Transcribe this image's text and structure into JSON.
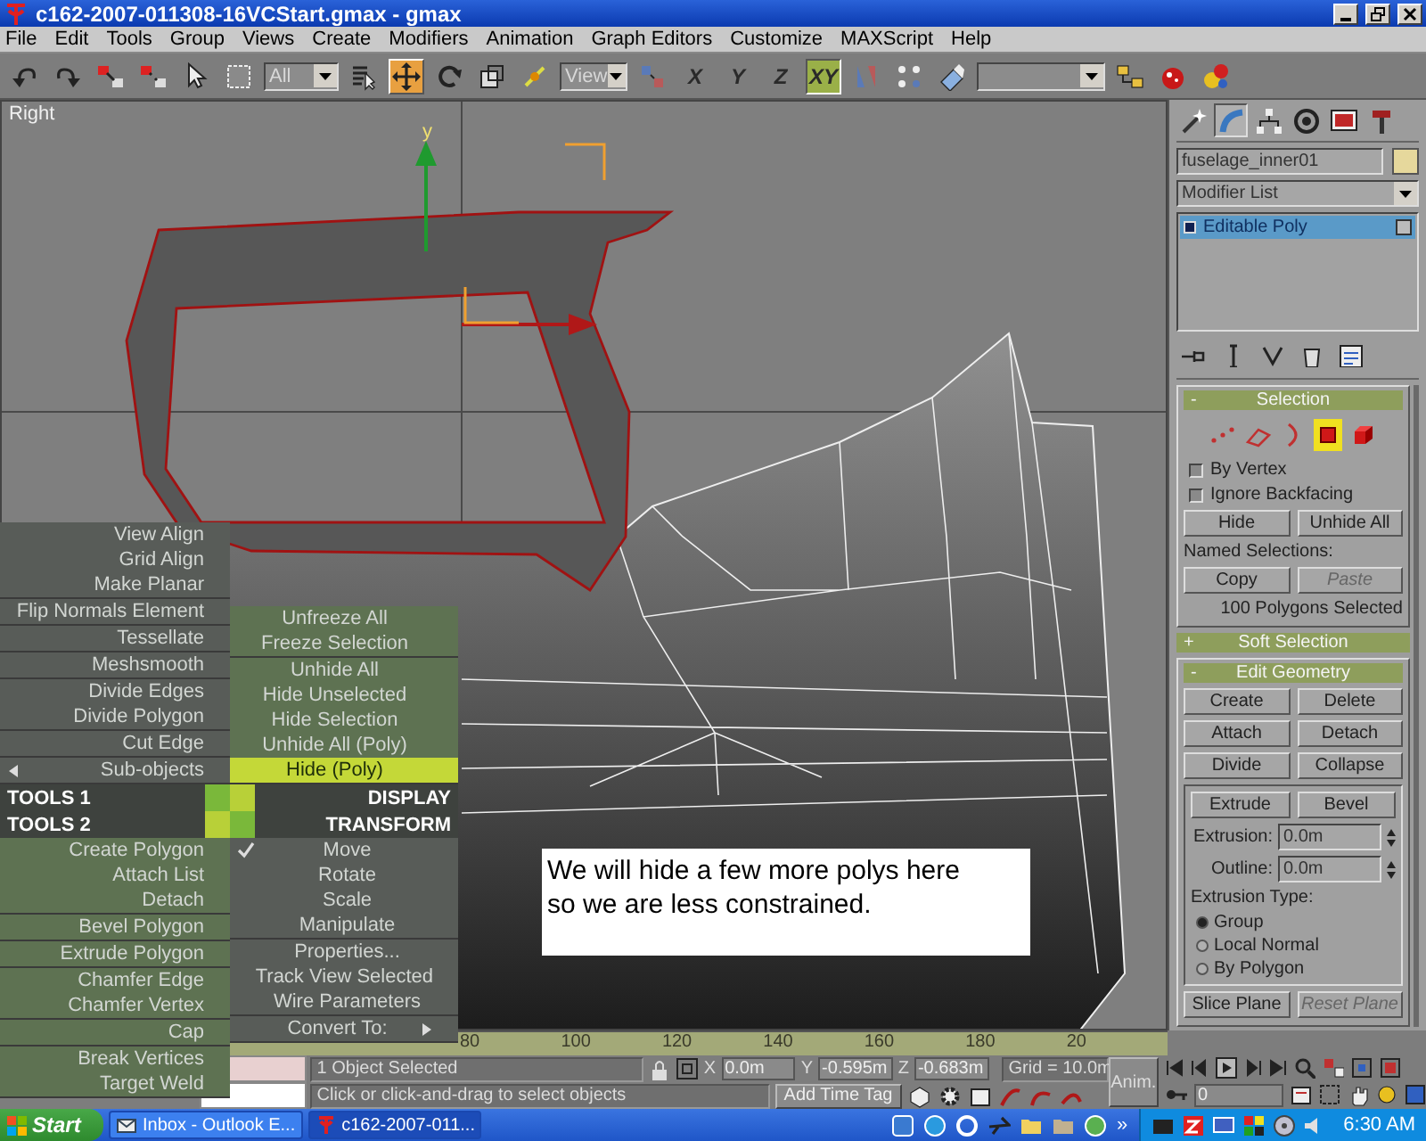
{
  "window": {
    "title": "c162-2007-011308-16VCStart.gmax - gmax"
  },
  "menu_bar": [
    "File",
    "Edit",
    "Tools",
    "Group",
    "Views",
    "Create",
    "Modifiers",
    "Animation",
    "Graph Editors",
    "Customize",
    "MAXScript",
    "Help"
  ],
  "toolbar": [
    {
      "kind": "button",
      "selected": false
    },
    {
      "kind": "button",
      "selected": false
    },
    {
      "kind": "button",
      "selected": false
    },
    {
      "kind": "button",
      "selected": false
    },
    {
      "kind": "button",
      "selected": false
    },
    {
      "kind": "button",
      "selected": false
    },
    {
      "kind": "dropdown",
      "value": "All"
    },
    {
      "kind": "button",
      "selected": false
    },
    {
      "kind": "button",
      "selected": true
    },
    {
      "kind": "button",
      "selected": false
    },
    {
      "kind": "button",
      "selected": false
    },
    {
      "kind": "button",
      "selected": false
    },
    {
      "kind": "dropdown",
      "value": "View"
    },
    {
      "kind": "button",
      "selected": false
    },
    {
      "kind": "letter",
      "label": "X",
      "selected": false
    },
    {
      "kind": "letter",
      "label": "Y",
      "selected": false
    },
    {
      "kind": "letter",
      "label": "Z",
      "selected": false
    },
    {
      "kind": "letter",
      "label": "XY",
      "selected": true
    },
    {
      "kind": "button",
      "selected": false
    },
    {
      "kind": "button",
      "selected": false
    },
    {
      "kind": "button",
      "selected": false
    },
    {
      "kind": "dropdown"
    },
    {
      "kind": "button",
      "selected": false
    },
    {
      "kind": "button",
      "selected": false
    },
    {
      "kind": "button",
      "selected": false
    }
  ],
  "viewport": {
    "label": "Right",
    "gizmo_label": "y",
    "note": "We will hide a few more polys here\nso we are less constrained."
  },
  "command_panel": {
    "tabs": [
      {
        "selected": false
      },
      {
        "selected": true
      },
      {
        "selected": false
      },
      {
        "selected": false
      },
      {
        "selected": false
      },
      {
        "selected": false
      }
    ],
    "object_name": "fuselage_inner01",
    "modifier_list": "Modifier List",
    "stack": [
      {
        "label": "Editable Poly",
        "selected": true
      }
    ],
    "selection_rollout": {
      "toggle": "-",
      "title": "Selection",
      "subobject_levels": [
        {
          "selected": false
        },
        {
          "selected": false
        },
        {
          "selected": false
        },
        {
          "selected": true
        },
        {
          "selected": false
        }
      ],
      "checkboxes": [
        {
          "label": "By Vertex",
          "checked": false
        },
        {
          "label": "Ignore Backfacing",
          "checked": false
        }
      ],
      "buttons": [
        {
          "label": "Hide",
          "disabled": false
        },
        {
          "label": "Unhide All",
          "disabled": false
        }
      ],
      "named_selections_label": "Named Selections:",
      "named_buttons": [
        {
          "label": "Copy",
          "disabled": false
        },
        {
          "label": "Paste",
          "disabled": true
        }
      ],
      "status": "100 Polygons Selected"
    },
    "soft_selection_rollout": {
      "toggle": "+",
      "title": "Soft Selection"
    },
    "edit_geometry_rollout": {
      "toggle": "-",
      "title": "Edit Geometry",
      "buttons": [
        "Create",
        "Delete",
        "Attach",
        "Detach",
        "Divide",
        "Collapse"
      ],
      "extrude_buttons": [
        "Extrude",
        "Bevel"
      ],
      "fields": [
        {
          "label": "Extrusion:",
          "value": "0.0m"
        },
        {
          "label": "Outline:",
          "value": "0.0m"
        }
      ],
      "extrusion_type_label": "Extrusion Type:",
      "radios": [
        {
          "label": "Group",
          "selected": true
        },
        {
          "label": "Local Normal",
          "selected": false
        },
        {
          "label": "By Polygon",
          "selected": false
        }
      ],
      "plane_buttons": [
        {
          "label": "Slice Plane",
          "disabled": false
        },
        {
          "label": "Reset Plane",
          "disabled": true
        }
      ]
    }
  },
  "quad_menu": {
    "tools1": {
      "title": "TOOLS 1",
      "groups": [
        [
          {
            "label": "View Align",
            "selected": false,
            "submenu": false
          },
          {
            "label": "Grid Align",
            "selected": false,
            "submenu": false
          },
          {
            "label": "Make Planar",
            "selected": false,
            "submenu": false
          }
        ],
        [
          {
            "label": "Flip Normals Element",
            "selected": false,
            "submenu": false
          }
        ],
        [
          {
            "label": "Tessellate",
            "selected": false,
            "submenu": false
          }
        ],
        [
          {
            "label": "Meshsmooth",
            "selected": false,
            "submenu": false
          }
        ],
        [
          {
            "label": "Divide Edges",
            "selected": false,
            "submenu": false
          },
          {
            "label": "Divide Polygon",
            "selected": false,
            "submenu": false
          }
        ],
        [
          {
            "label": "Cut Edge",
            "selected": false,
            "submenu": false
          }
        ],
        [
          {
            "label": "Sub-objects",
            "selected": false,
            "submenu": true
          }
        ]
      ]
    },
    "display": {
      "title": "DISPLAY",
      "groups": [
        [
          {
            "label": "Unfreeze All",
            "selected": false,
            "submenu": false
          },
          {
            "label": "Freeze Selection",
            "selected": false,
            "submenu": false
          }
        ],
        [
          {
            "label": "Unhide All",
            "selected": false,
            "submenu": false
          },
          {
            "label": "Hide Unselected",
            "selected": false,
            "submenu": false
          },
          {
            "label": "Hide Selection",
            "selected": false,
            "submenu": false
          },
          {
            "label": "Unhide All (Poly)",
            "selected": false,
            "submenu": false
          },
          {
            "label": "Hide (Poly)",
            "selected": true,
            "submenu": false
          }
        ]
      ]
    },
    "tools2": {
      "title": "TOOLS 2",
      "groups": [
        [
          {
            "label": "Create Polygon",
            "selected": false,
            "submenu": false
          },
          {
            "label": "Attach List",
            "selected": false,
            "submenu": false
          },
          {
            "label": "Detach",
            "selected": false,
            "submenu": false
          }
        ],
        [
          {
            "label": "Bevel Polygon",
            "selected": false,
            "submenu": false
          }
        ],
        [
          {
            "label": "Extrude Polygon",
            "selected": false,
            "submenu": false
          }
        ],
        [
          {
            "label": "Chamfer Edge",
            "selected": false,
            "submenu": false
          },
          {
            "label": "Chamfer Vertex",
            "selected": false,
            "submenu": false
          }
        ],
        [
          {
            "label": "Cap",
            "selected": false,
            "submenu": false
          }
        ],
        [
          {
            "label": "Break Vertices",
            "selected": false,
            "submenu": false
          },
          {
            "label": "Target Weld",
            "selected": false,
            "submenu": false
          }
        ]
      ]
    },
    "transform": {
      "title": "TRANSFORM",
      "groups": [
        [
          {
            "label": "Move",
            "selected": false,
            "submenu": false,
            "checked": true
          },
          {
            "label": "Rotate",
            "selected": false,
            "submenu": false,
            "checked": false
          },
          {
            "label": "Scale",
            "selected": false,
            "submenu": false,
            "checked": false
          },
          {
            "label": "Manipulate",
            "selected": false,
            "submenu": false,
            "checked": false
          }
        ],
        [
          {
            "label": "Properties...",
            "selected": false,
            "submenu": false,
            "checked": false
          },
          {
            "label": "Track View Selected",
            "selected": false,
            "submenu": false,
            "checked": false
          },
          {
            "label": "Wire Parameters",
            "selected": false,
            "submenu": false,
            "checked": false
          }
        ],
        [
          {
            "label": "Convert To:",
            "selected": false,
            "submenu": true,
            "checked": false
          }
        ]
      ]
    }
  },
  "track_bar": {
    "ticks": [
      "80",
      "100",
      "120",
      "140",
      "160",
      "180",
      "20"
    ]
  },
  "status_bar": {
    "selection": "1 Object Selected",
    "prompt": "Click or click-and-drag to select objects",
    "coords": [
      {
        "label": "X",
        "value": "0.0m"
      },
      {
        "label": "Y",
        "value": "-0.595m"
      },
      {
        "label": "Z",
        "value": "-0.683m"
      }
    ],
    "grid": "Grid = 10.0m",
    "time_tag": "Add Time Tag",
    "anim_button": "Anim.",
    "frame": "0"
  },
  "taskbar": {
    "start": "Start",
    "tasks": [
      {
        "label": "Inbox - Outlook E...",
        "selected": false
      },
      {
        "label": "c162-2007-011...",
        "selected": true
      }
    ],
    "chevron": "»",
    "clock": "6:30 AM"
  }
}
